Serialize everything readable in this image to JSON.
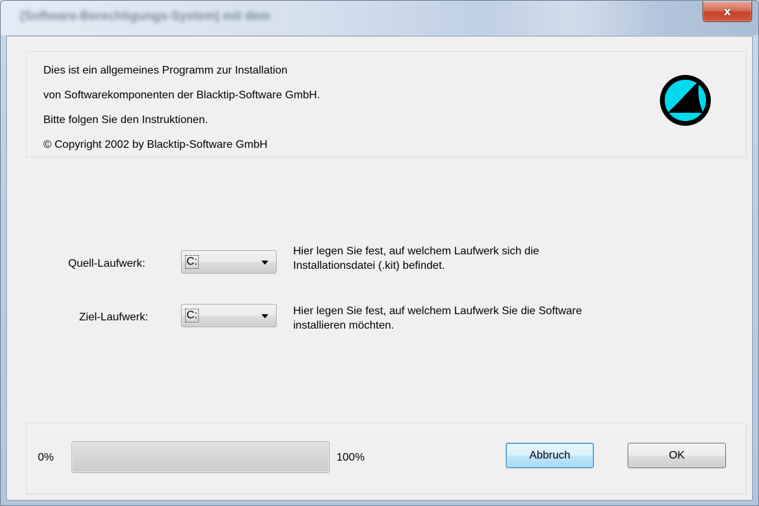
{
  "window": {
    "title": "(Software-Berechtigungs-System) mit dem",
    "close_glyph": "x"
  },
  "info": {
    "lines": [
      "Dies ist ein allgemeines Programm zur Installation",
      "von Softwarekomponenten der Blacktip-Software GmbH.",
      "Bitte folgen Sie den Instruktionen.",
      "© Copyright 2002 by Blacktip-Software GmbH"
    ],
    "logo_icon": "blacktip-fin-logo-icon",
    "logo_colors": {
      "ring": "#00d9ef",
      "fill": "#000000"
    }
  },
  "source": {
    "label": "Quell-Laufwerk:",
    "value": "C:",
    "hint_line1": "Hier legen Sie fest, auf welchem Laufwerk sich die",
    "hint_line2": "Installationsdatei (.kit) befindet."
  },
  "target": {
    "label": "Ziel-Laufwerk:",
    "value": "C:",
    "hint_line1": "Hier legen Sie fest, auf welchem Laufwerk Sie die Software",
    "hint_line2": "installieren möchten."
  },
  "progress": {
    "min_label": "0%",
    "max_label": "100%",
    "value": 0
  },
  "buttons": {
    "cancel_label": "Abbruch",
    "ok_label": "OK"
  },
  "colors": {
    "accent_default_button": "#3c7fb1",
    "close_button": "#c2412a"
  }
}
